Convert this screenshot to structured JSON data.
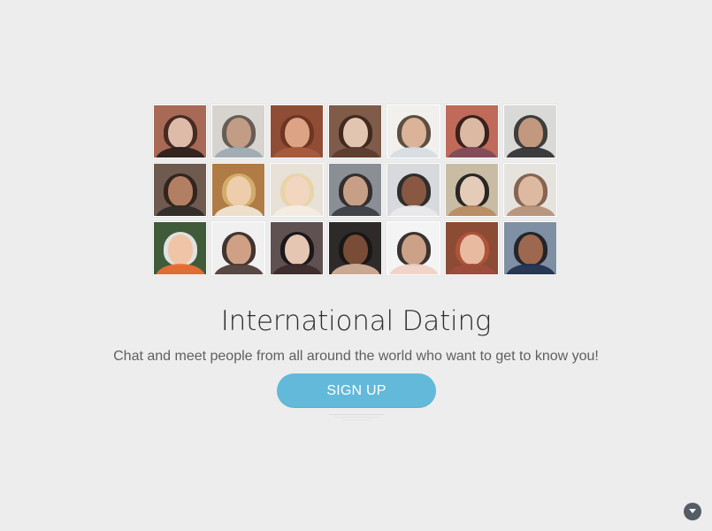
{
  "hero": {
    "title": "International Dating",
    "subtitle": "Chat and meet people from all around the world who want to get to know you!",
    "signup_label": "SIGN UP"
  },
  "photos": [
    {
      "name": "profile-photo-1",
      "bg": "#a86a56",
      "hair": "#3c231c",
      "face": "#e7c2b1",
      "shoulders": "#2a1d1a"
    },
    {
      "name": "profile-photo-2",
      "bg": "#d7d4cf",
      "hair": "#5a5048",
      "face": "#c79f87",
      "shoulders": "#9da8b3"
    },
    {
      "name": "profile-photo-3",
      "bg": "#8f4d36",
      "hair": "#6b3320",
      "face": "#e1aa8b",
      "shoulders": "#a95c3e"
    },
    {
      "name": "profile-photo-4",
      "bg": "#7e5c49",
      "hair": "#3b2318",
      "face": "#ebcdb9",
      "shoulders": "#5b3d2e"
    },
    {
      "name": "profile-photo-5",
      "bg": "#f2f0ec",
      "hair": "#4e3c2e",
      "face": "#e0b89d",
      "shoulders": "#d7dce2"
    },
    {
      "name": "profile-photo-6",
      "bg": "#c06a5a",
      "hair": "#2a1a15",
      "face": "#e5c2aa",
      "shoulders": "#7f4a58"
    },
    {
      "name": "profile-photo-7",
      "bg": "#d9d9d7",
      "hair": "#2c2b2a",
      "face": "#c99d82",
      "shoulders": "#2f2f31"
    },
    {
      "name": "profile-photo-8",
      "bg": "#6f5a4f",
      "hair": "#2a1f18",
      "face": "#b98467",
      "shoulders": "#2e2a27"
    },
    {
      "name": "profile-photo-9",
      "bg": "#b07b45",
      "hair": "#d6b16e",
      "face": "#efcfb0",
      "shoulders": "#f2e7d8"
    },
    {
      "name": "profile-photo-10",
      "bg": "#e8e1d7",
      "hair": "#e7d4a3",
      "face": "#f2d6c0",
      "shoulders": "#f4ede3"
    },
    {
      "name": "profile-photo-11",
      "bg": "#8a8f96",
      "hair": "#2a2320",
      "face": "#d0a58c",
      "shoulders": "#3b3d43"
    },
    {
      "name": "profile-photo-12",
      "bg": "#d8d9dd",
      "hair": "#1d1b1a",
      "face": "#8d5b43",
      "shoulders": "#eaeaec"
    },
    {
      "name": "profile-photo-13",
      "bg": "#c8bca5",
      "hair": "#171515",
      "face": "#efd5c2",
      "shoulders": "#b88b5f"
    },
    {
      "name": "profile-photo-14",
      "bg": "#e6e3df",
      "hair": "#7a5542",
      "face": "#e3bea5",
      "shoulders": "#b58f77"
    },
    {
      "name": "profile-photo-15",
      "bg": "#3f5b3a",
      "hair": "#f1f1f1",
      "face": "#f0c2a3",
      "shoulders": "#ed6f34"
    },
    {
      "name": "profile-photo-16",
      "bg": "#f0f0f0",
      "hair": "#2e1f19",
      "face": "#d7a78a",
      "shoulders": "#4b3a34"
    },
    {
      "name": "profile-photo-17",
      "bg": "#5f5151",
      "hair": "#141214",
      "face": "#efd0bb",
      "shoulders": "#3d2b2e"
    },
    {
      "name": "profile-photo-18",
      "bg": "#2f2a2a",
      "hair": "#171414",
      "face": "#7d4f38",
      "shoulders": "#d8b39a"
    },
    {
      "name": "profile-photo-19",
      "bg": "#f4f4f4",
      "hair": "#251e1c",
      "face": "#d3a88c",
      "shoulders": "#f0d0c3"
    },
    {
      "name": "profile-photo-20",
      "bg": "#8b4b34",
      "hair": "#b4543b",
      "face": "#ebc1a6",
      "shoulders": "#9f4d3d"
    },
    {
      "name": "profile-photo-21",
      "bg": "#7f8fa4",
      "hair": "#19191b",
      "face": "#a46b51",
      "shoulders": "#21304c"
    }
  ]
}
